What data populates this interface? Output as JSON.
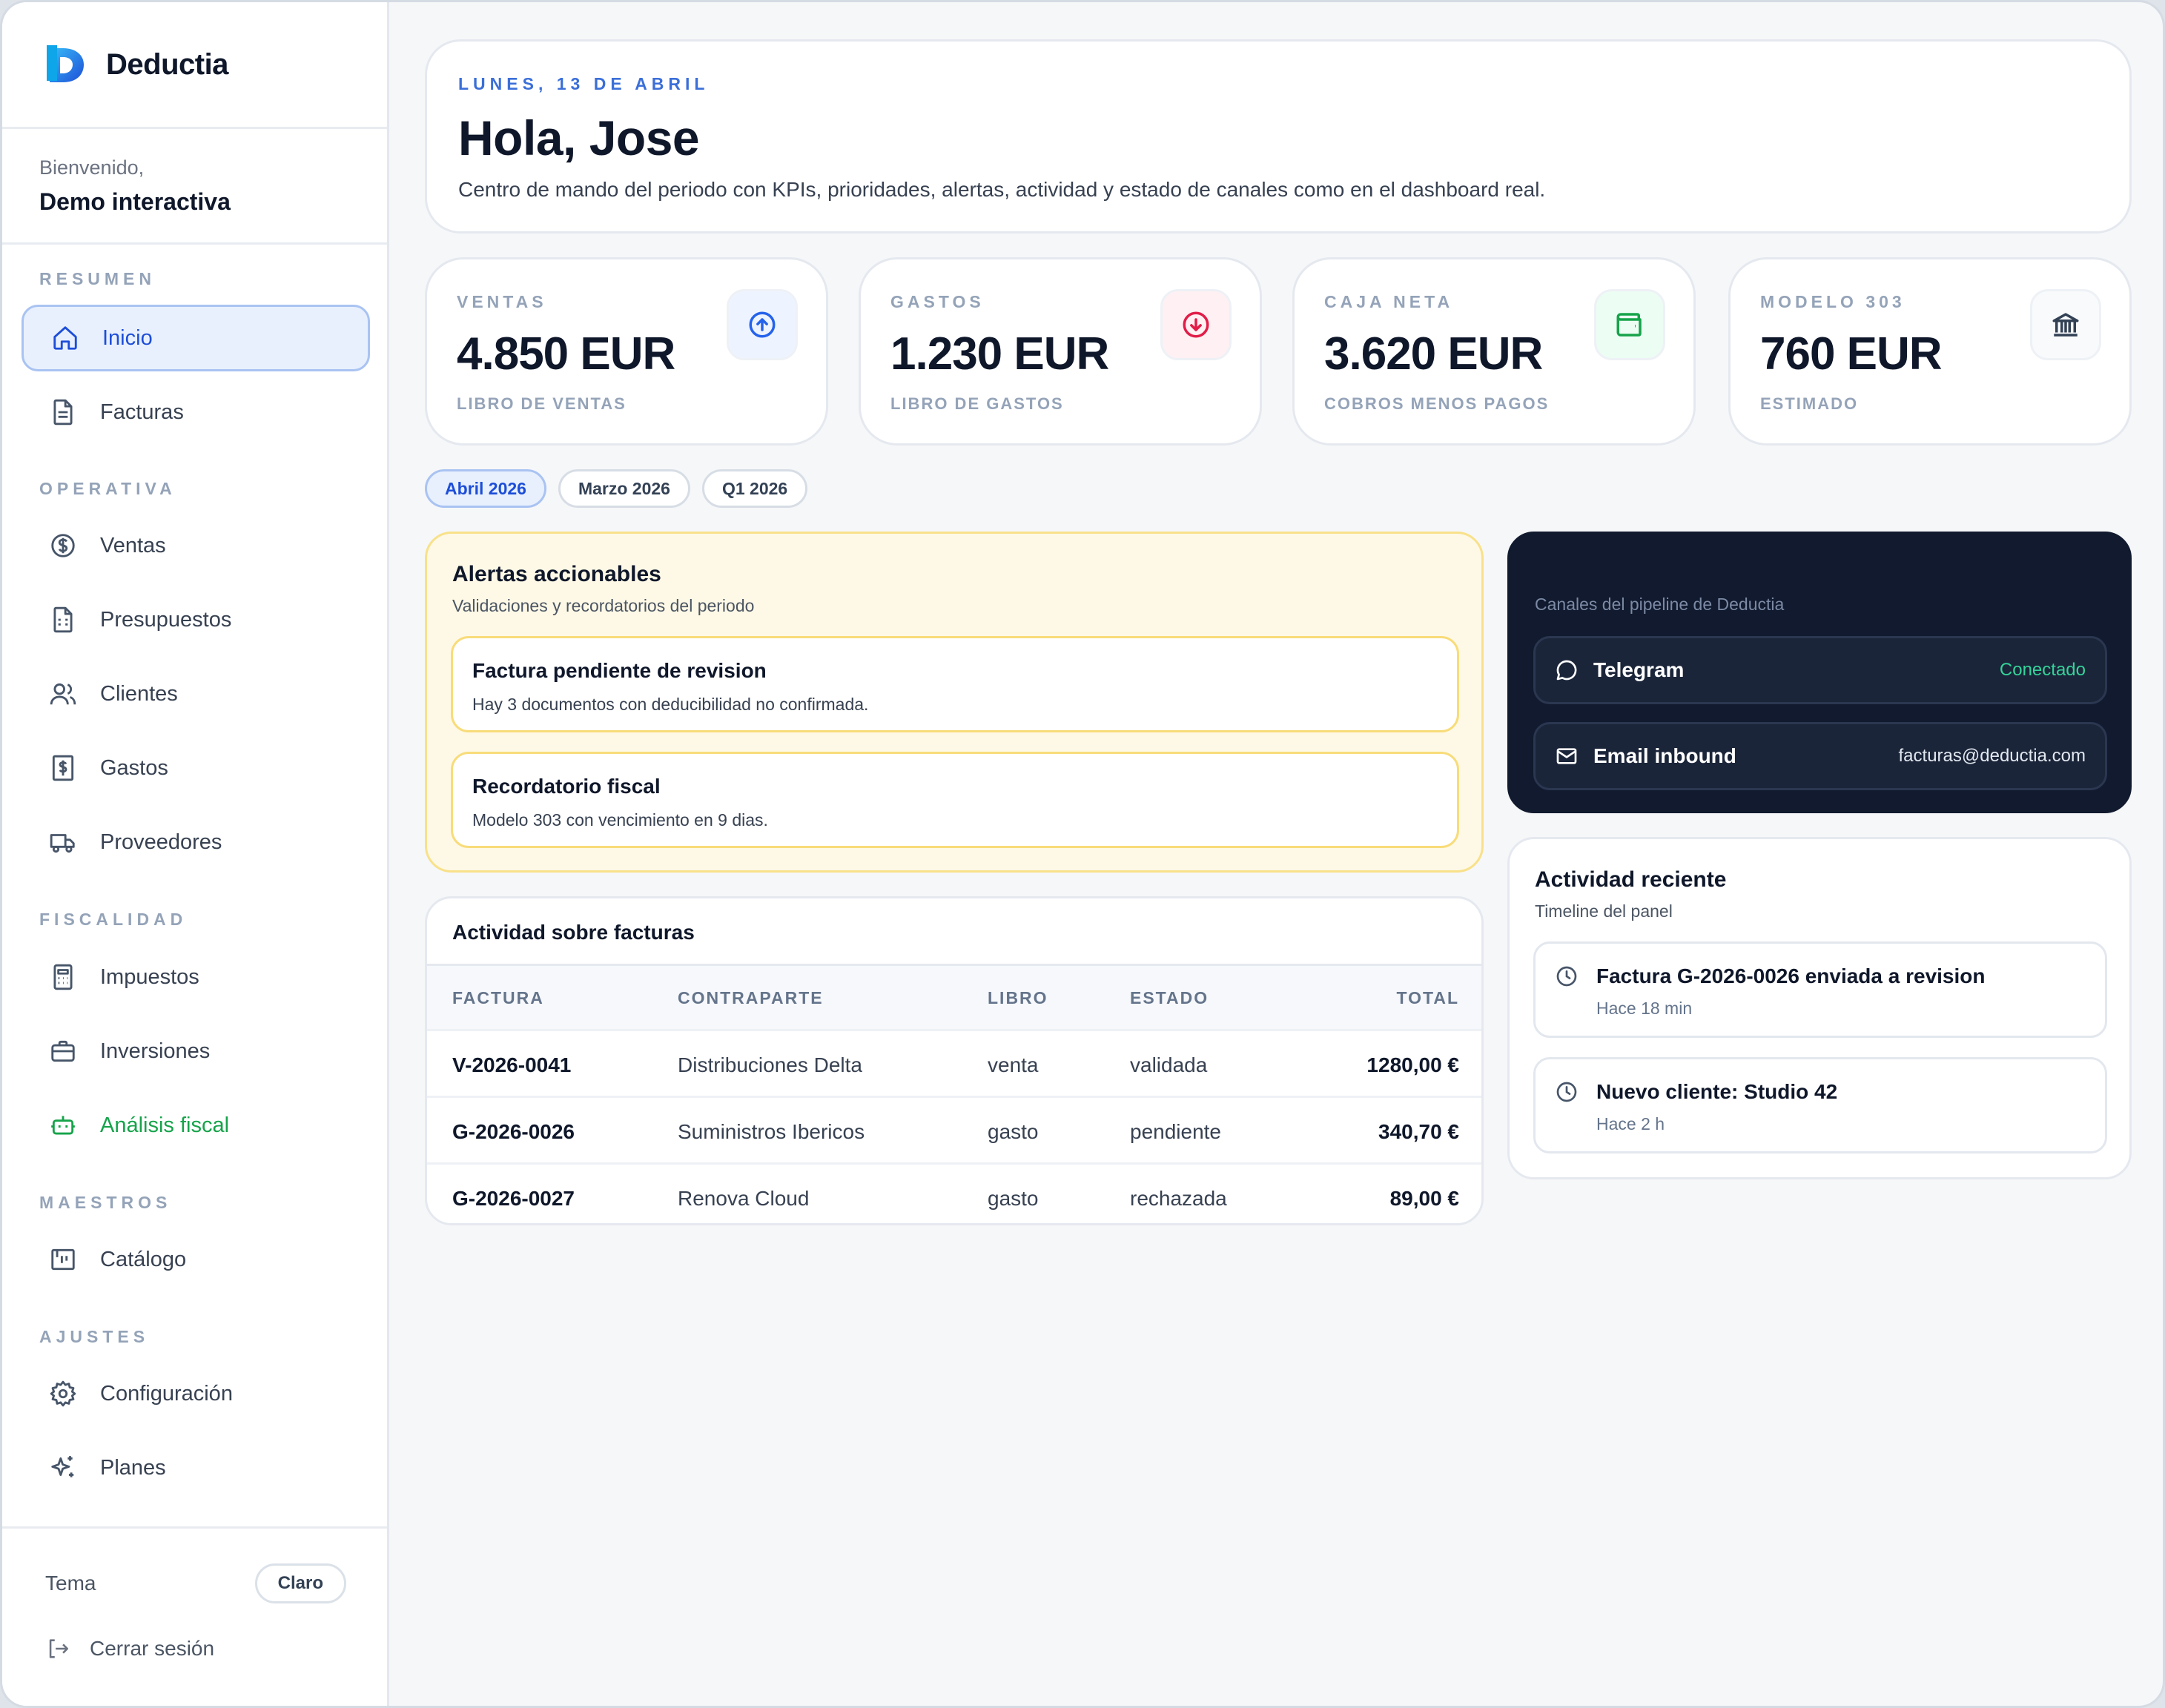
{
  "app": {
    "name": "Deductia"
  },
  "user": {
    "greeting": "Bienvenido,",
    "name": "Demo interactiva"
  },
  "sidebar": {
    "sections": [
      {
        "title": "RESUMEN",
        "items": [
          {
            "label": "Inicio",
            "icon": "home-icon",
            "active": true
          },
          {
            "label": "Facturas",
            "icon": "document-icon"
          }
        ]
      },
      {
        "title": "OPERATIVA",
        "items": [
          {
            "label": "Ventas",
            "icon": "dollar-circle-icon"
          },
          {
            "label": "Presupuestos",
            "icon": "calculator-doc-icon"
          },
          {
            "label": "Clientes",
            "icon": "users-icon"
          },
          {
            "label": "Gastos",
            "icon": "receipt-dollar-icon"
          },
          {
            "label": "Proveedores",
            "icon": "truck-icon"
          }
        ]
      },
      {
        "title": "FISCALIDAD",
        "items": [
          {
            "label": "Impuestos",
            "icon": "calculator-icon"
          },
          {
            "label": "Inversiones",
            "icon": "briefcase-icon"
          },
          {
            "label": "Análisis fiscal",
            "icon": "bot-icon",
            "highlight": "#16a34a"
          }
        ]
      },
      {
        "title": "MAESTROS",
        "items": [
          {
            "label": "Catálogo",
            "icon": "catalog-icon"
          }
        ]
      },
      {
        "title": "AJUSTES",
        "items": [
          {
            "label": "Configuración",
            "icon": "gear-icon"
          },
          {
            "label": "Planes",
            "icon": "sparkles-icon"
          }
        ]
      }
    ],
    "theme_label": "Tema",
    "theme_value": "Claro",
    "logout_label": "Cerrar sesión"
  },
  "hero": {
    "date": "LUNES, 13 DE ABRIL",
    "title": "Hola, Jose",
    "description": "Centro de mando del periodo con KPIs, prioridades, alertas, actividad y estado de canales como en el dashboard real."
  },
  "kpis": [
    {
      "label": "VENTAS",
      "value": "4.850 EUR",
      "sub": "LIBRO DE VENTAS",
      "icon": "arrow-up-circle-icon",
      "color": "#2563eb"
    },
    {
      "label": "GASTOS",
      "value": "1.230 EUR",
      "sub": "LIBRO DE GASTOS",
      "icon": "arrow-down-circle-icon",
      "color": "#e11d48"
    },
    {
      "label": "CAJA NETA",
      "value": "3.620 EUR",
      "sub": "COBROS MENOS PAGOS",
      "icon": "wallet-icon",
      "color": "#16a34a"
    },
    {
      "label": "MODELO 303",
      "value": "760 EUR",
      "sub": "ESTIMADO",
      "icon": "bank-icon",
      "color": "#334155"
    }
  ],
  "periods": [
    {
      "label": "Abril 2026",
      "active": true
    },
    {
      "label": "Marzo 2026"
    },
    {
      "label": "Q1 2026"
    }
  ],
  "alerts": {
    "title": "Alertas accionables",
    "subtitle": "Validaciones y recordatorios del periodo",
    "items": [
      {
        "title": "Factura pendiente de revision",
        "desc": "Hay 3 documentos con deducibilidad no confirmada."
      },
      {
        "title": "Recordatorio fiscal",
        "desc": "Modelo 303 con vencimiento en 9 dias."
      }
    ]
  },
  "invoices": {
    "title": "Actividad sobre facturas",
    "columns": [
      "FACTURA",
      "CONTRAPARTE",
      "LIBRO",
      "ESTADO",
      "TOTAL"
    ],
    "rows": [
      [
        "V-2026-0041",
        "Distribuciones Delta",
        "venta",
        "validada",
        "1280,00 €"
      ],
      [
        "G-2026-0026",
        "Suministros Ibericos",
        "gasto",
        "pendiente",
        "340,70 €"
      ],
      [
        "G-2026-0027",
        "Renova Cloud",
        "gasto",
        "rechazada",
        "89,00 €"
      ]
    ]
  },
  "channels": {
    "subtitle": "Canales del pipeline de Deductia",
    "items": [
      {
        "name": "Telegram",
        "status": "Conectado",
        "icon": "chat-bubble-icon"
      },
      {
        "name": "Email inbound",
        "status": "facturas@deductia.com",
        "icon": "mail-icon"
      }
    ]
  },
  "activity": {
    "title": "Actividad reciente",
    "subtitle": "Timeline del panel",
    "items": [
      {
        "title": "Factura G-2026-0026 enviada a revision",
        "time": "Hace 18 min",
        "icon": "clock-icon"
      },
      {
        "title": "Nuevo cliente: Studio 42",
        "time": "Hace 2 h",
        "icon": "clock-icon"
      }
    ]
  },
  "colors": {
    "accent": "#1d4ed8",
    "dark_panel": "#111a2e",
    "alert_bg": "#fef9e6",
    "success": "#34d399"
  }
}
